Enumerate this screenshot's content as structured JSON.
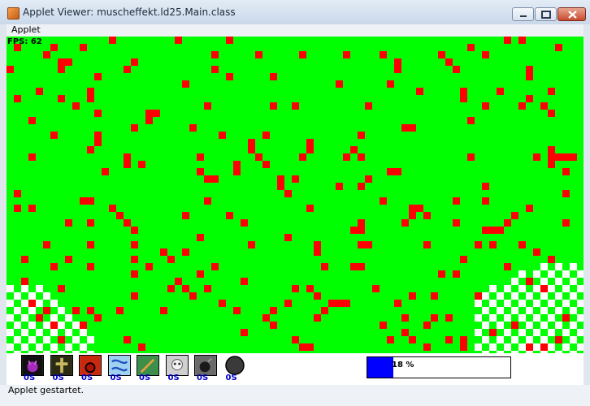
{
  "window": {
    "title": "Applet Viewer: muscheffekt.ld25.Main.class"
  },
  "menu": {
    "items": [
      "Applet"
    ]
  },
  "game": {
    "fps_label": "FPS: 62",
    "colors": {
      "grass": "#00ff00",
      "infected": "#ff0000",
      "checker": "#ffffff",
      "hud": "#ffffff",
      "bar": "#0000ff"
    },
    "slots": [
      {
        "icon": "purple-bug-icon",
        "count": "0S"
      },
      {
        "icon": "cross-icon",
        "count": "0S"
      },
      {
        "icon": "red-bomb-icon",
        "count": "0S"
      },
      {
        "icon": "blue-wave-icon",
        "count": "0S"
      },
      {
        "icon": "sword-icon",
        "count": "0S"
      },
      {
        "icon": "skull-icon",
        "count": "0S"
      },
      {
        "icon": "black-bomb-icon",
        "count": "0S"
      },
      {
        "icon": "black-orb-icon",
        "count": "0S"
      }
    ],
    "progress": {
      "label": "18 %",
      "fraction": 0.18
    }
  },
  "status": {
    "text": "Applet gestartet."
  }
}
